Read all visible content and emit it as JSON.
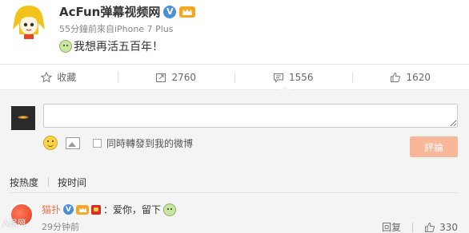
{
  "post": {
    "author": "AcFun弹幕视频网",
    "verified_badge": "V",
    "meta": "55分鐘前來自iPhone 7 Plus",
    "text": "我想再活五百年！"
  },
  "actions": [
    {
      "label": "收藏",
      "icon": "star-icon"
    },
    {
      "label": "2760",
      "icon": "repost-icon"
    },
    {
      "label": "1556",
      "icon": "comment-icon"
    },
    {
      "label": "1620",
      "icon": "thumbs-up-icon"
    }
  ],
  "comment_box": {
    "input_value": "",
    "repost_checkbox_label": "同時轉發到我的微博",
    "submit_label": "評論"
  },
  "sort": {
    "by_hot": "按热度",
    "by_time": "按时间"
  },
  "comments": [
    {
      "user": "猫扑",
      "text": "：爱你，留下",
      "time": "29分钟前",
      "reply_label": "回复",
      "likes": "330"
    }
  ],
  "watermark": "人民网",
  "colors": {
    "verified": "#4a90d9",
    "username": "#eb7350",
    "submit_button": "#f9b79a"
  }
}
